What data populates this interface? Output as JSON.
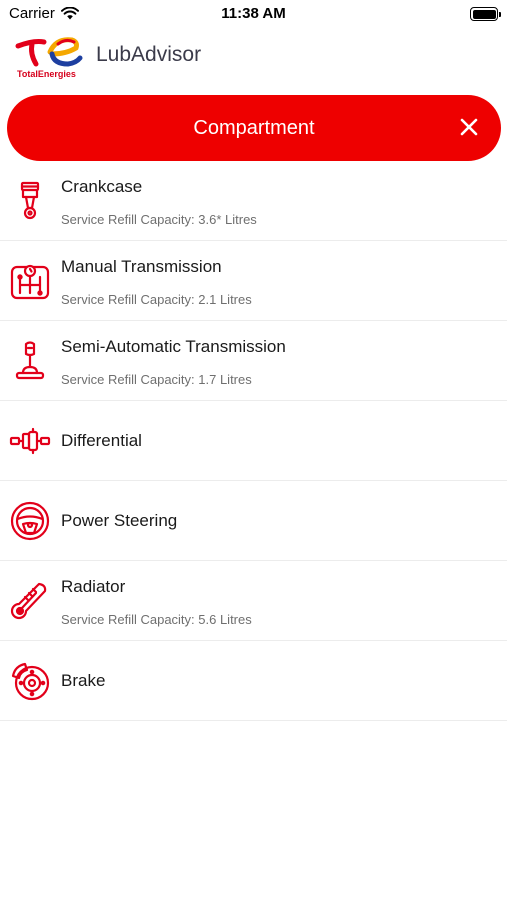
{
  "status_bar": {
    "carrier": "Carrier",
    "time": "11:38 AM"
  },
  "header": {
    "brand_text": "TotalEnergies",
    "title": "LubAdvisor"
  },
  "compartment_bar": {
    "title": "Compartment"
  },
  "colors": {
    "accent": "#ee0000",
    "icon": "#e2001a",
    "title_text": "#3b3b4a"
  },
  "items": [
    {
      "name": "Crankcase",
      "capacity": "Service Refill Capacity: 3.6* Litres",
      "icon": "piston-icon"
    },
    {
      "name": "Manual Transmission",
      "capacity": "Service Refill Capacity: 2.1 Litres",
      "icon": "manual-gearbox-icon"
    },
    {
      "name": "Semi-Automatic Transmission",
      "capacity": "Service Refill Capacity: 1.7 Litres",
      "icon": "gear-lever-icon"
    },
    {
      "name": "Differential",
      "capacity": "",
      "icon": "differential-icon"
    },
    {
      "name": "Power Steering",
      "capacity": "",
      "icon": "steering-wheel-icon"
    },
    {
      "name": "Radiator",
      "capacity": "Service Refill Capacity: 5.6 Litres",
      "icon": "thermometer-icon"
    },
    {
      "name": "Brake",
      "capacity": "",
      "icon": "brake-disc-icon"
    }
  ]
}
